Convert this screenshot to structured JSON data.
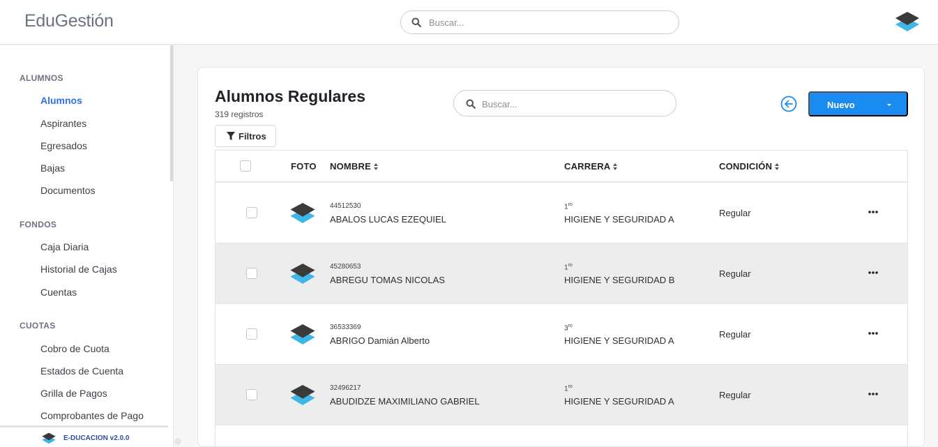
{
  "app": {
    "brand": "EduGestión"
  },
  "top_search": {
    "placeholder": "Buscar..."
  },
  "sidebar": {
    "sections": [
      {
        "title": "ALUMNOS",
        "items": [
          "Alumnos",
          "Aspirantes",
          "Egresados",
          "Bajas",
          "Documentos"
        ]
      },
      {
        "title": "FONDOS",
        "items": [
          "Caja Diaria",
          "Historial de Cajas",
          "Cuentas"
        ]
      },
      {
        "title": "CUOTAS",
        "items": [
          "Cobro de Cuota",
          "Estados de Cuenta",
          "Grilla de Pagos",
          "Comprobantes de Pago"
        ]
      }
    ],
    "active_item": "Alumnos",
    "footer": "E-DUCACION v2.0.0"
  },
  "page": {
    "title": "Alumnos Regulares",
    "subtitle": "319 registros",
    "filters_label": "Filtros",
    "search_placeholder": "Buscar...",
    "new_label": "Nuevo"
  },
  "table": {
    "headers": {
      "photo": "FOTO",
      "name": "NOMBRE",
      "career": "CARRERA",
      "condition": "CONDICIÓN"
    },
    "rows": [
      {
        "dni": "44512530",
        "name": "ABALOS LUCAS EZEQUIEL",
        "year": "1",
        "year_suffix": "ro",
        "career": "HIGIENE Y SEGURIDAD A",
        "condition": "Regular"
      },
      {
        "dni": "45280653",
        "name": "ABREGU TOMAS NICOLAS",
        "year": "1",
        "year_suffix": "ro",
        "career": "HIGIENE Y SEGURIDAD B",
        "condition": "Regular"
      },
      {
        "dni": "36533369",
        "name": "ABRIGO Damián Alberto",
        "year": "3",
        "year_suffix": "ro",
        "career": "HIGIENE Y SEGURIDAD A",
        "condition": "Regular"
      },
      {
        "dni": "32496217",
        "name": "ABUDIDZE MAXIMILIANO GABRIEL",
        "year": "1",
        "year_suffix": "ro",
        "career": "HIGIENE Y SEGURIDAD A",
        "condition": "Regular"
      }
    ]
  },
  "icons": {
    "search": "search-icon",
    "logo": "graduation-cap-icon",
    "filter": "filter-icon",
    "back": "arrow-left-circle-icon",
    "row_menu": "ellipsis-icon"
  },
  "colors": {
    "accent": "#1a8cf0",
    "active_nav": "#2f6fe0",
    "row_alt": "#ededed"
  }
}
